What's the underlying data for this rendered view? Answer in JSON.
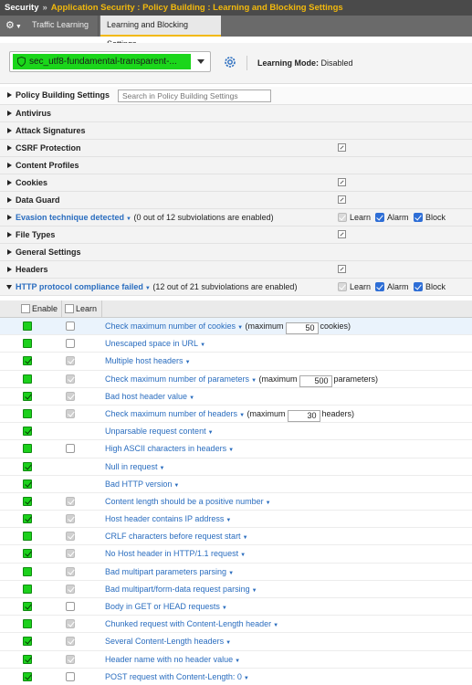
{
  "breadcrumb": {
    "root": "Security",
    "separator": "»",
    "path": "Application Security : Policy Building : Learning and Blocking Settings"
  },
  "tabs": [
    {
      "label": "Traffic Learning",
      "active": false
    },
    {
      "label": "Learning and Blocking Settings",
      "active": true
    }
  ],
  "policy": {
    "name": "sec_utf8-fundamental-transparent-...",
    "learning_mode_label": "Learning Mode:",
    "learning_mode_value": "Disabled"
  },
  "settings": {
    "header_label": "Policy Building Settings",
    "search_placeholder": "Search in Policy Building Settings",
    "sections": [
      {
        "label": "Antivirus"
      },
      {
        "label": "Attack Signatures"
      },
      {
        "label": "CSRF Protection"
      },
      {
        "label": "Content Profiles"
      },
      {
        "label": "Cookies"
      },
      {
        "label": "Data Guard"
      },
      {
        "label": "Evasion technique detected",
        "count": "(0 out of 12 subviolations are enabled)"
      },
      {
        "label": "File Types"
      },
      {
        "label": "General Settings"
      },
      {
        "label": "Headers"
      },
      {
        "label": "HTTP protocol compliance failed",
        "count": "(12 out of 21 subviolations are enabled)"
      }
    ],
    "flags": {
      "learn": "Learn",
      "alarm": "Alarm",
      "block": "Block"
    }
  },
  "subviolations": {
    "enable_header": "Enable",
    "learn_header": "Learn",
    "rows": [
      {
        "name": "Check maximum number of cookies",
        "pre": "(maximum",
        "value": "50",
        "post": "cookies)"
      },
      {
        "name": "Unescaped space in URL"
      },
      {
        "name": "Multiple host headers"
      },
      {
        "name": "Check maximum number of parameters",
        "pre": "(maximum",
        "value": "500",
        "post": "parameters)"
      },
      {
        "name": "Bad host header value"
      },
      {
        "name": "Check maximum number of headers",
        "pre": "(maximum",
        "value": "30",
        "post": "headers)"
      },
      {
        "name": "Unparsable request content"
      },
      {
        "name": "High ASCII characters in headers"
      },
      {
        "name": "Null in request"
      },
      {
        "name": "Bad HTTP version"
      },
      {
        "name": "Content length should be a positive number"
      },
      {
        "name": "Host header contains IP address"
      },
      {
        "name": "CRLF characters before request start"
      },
      {
        "name": "No Host header in HTTP/1.1 request"
      },
      {
        "name": "Bad multipart parameters parsing"
      },
      {
        "name": "Bad multipart/form-data request parsing"
      },
      {
        "name": "Body in GET or HEAD requests"
      },
      {
        "name": "Chunked request with Content-Length header"
      },
      {
        "name": "Several Content-Length headers"
      },
      {
        "name": "Header name with no header value"
      },
      {
        "name": "POST request with Content-Length: 0"
      }
    ]
  },
  "colors": {
    "accent": "#f2b90d",
    "link": "#2a6dbf",
    "enabled_green": "#1cd01c",
    "checkbox_blue": "#2e6ed6"
  }
}
